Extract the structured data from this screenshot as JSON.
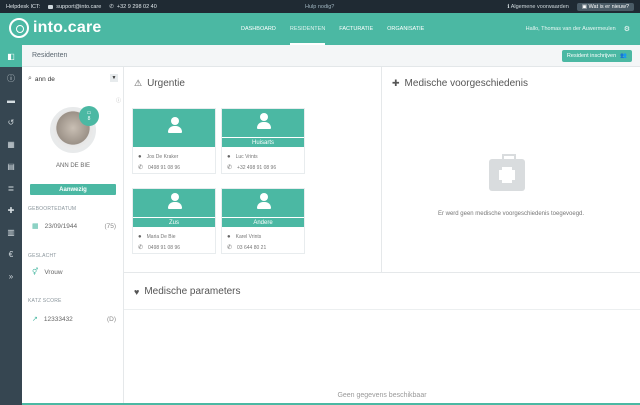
{
  "topbar": {
    "helpdesk_label": "Helpdesk ICT:",
    "email": "support@into.care",
    "phone": "+32 9 298 02 40",
    "help": "Hulp nodig?",
    "conditions": "Algemene voorwaarden",
    "whats_new": "Wat is er nieuw?"
  },
  "nav": {
    "logo": "into.care",
    "items": [
      "DASHBOARD",
      "RESIDENTEN",
      "FACTURATIE",
      "ORGANISATIE"
    ],
    "active": "RESIDENTEN",
    "greeting": "Hallo, Thomas van der Auwermeulen"
  },
  "subheader": {
    "title": "Residenten",
    "button": "Resident inschrijven"
  },
  "resident": {
    "search_value": "ann de",
    "name": "ANN DE BIE",
    "room": "8",
    "status": "Aanwezig",
    "fields": [
      {
        "label": "GEBOORTEDATUM",
        "value": "23/09/1944",
        "extra": "(75)"
      },
      {
        "label": "GESLACHT",
        "value": "Vrouw",
        "extra": ""
      },
      {
        "label": "KATZ SCORE",
        "value": "12333432",
        "extra": "(D)"
      }
    ]
  },
  "urgency": {
    "title": "Urgentie",
    "contacts": [
      {
        "role": "",
        "name": "Jos De Kraker",
        "phone": "0498 91 08 96"
      },
      {
        "role": "Huisarts",
        "name": "Luc Vrints",
        "phone": "+32 498 91 08 96"
      },
      {
        "role": "Zus",
        "name": "Maria De Bie",
        "phone": "0498 91 08 96"
      },
      {
        "role": "Andere",
        "name": "Karel Vrints",
        "phone": "03 644 80 21"
      }
    ]
  },
  "history": {
    "title": "Medische voorgeschiedenis",
    "empty": "Er werd geen medische voorgeschiedenis toegevoegd."
  },
  "parameters": {
    "title": "Medische parameters",
    "empty": "Geen gegevens beschikbaar"
  },
  "colors": {
    "accent": "#4bb8a3",
    "sidebar": "#364651",
    "topbar": "#1f2a33"
  }
}
